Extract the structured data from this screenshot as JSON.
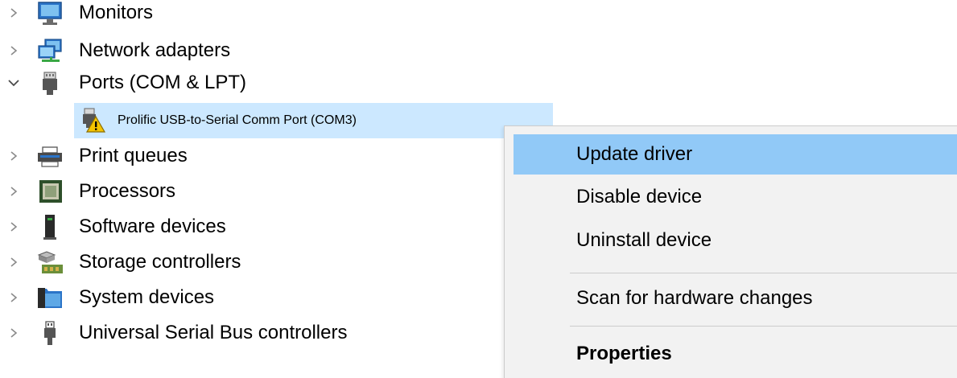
{
  "tree": {
    "items": [
      {
        "label": "Monitors",
        "icon": "monitor-icon",
        "expanded": false
      },
      {
        "label": "Network adapters",
        "icon": "network-adapter-icon",
        "expanded": false
      },
      {
        "label": "Ports (COM & LPT)",
        "icon": "port-icon",
        "expanded": true,
        "children": [
          {
            "label": "Prolific USB-to-Serial Comm Port (COM3)",
            "icon": "port-warning-icon",
            "selected": true
          }
        ]
      },
      {
        "label": "Print queues",
        "icon": "printer-icon",
        "expanded": false
      },
      {
        "label": "Processors",
        "icon": "processor-icon",
        "expanded": false
      },
      {
        "label": "Software devices",
        "icon": "software-device-icon",
        "expanded": false
      },
      {
        "label": "Storage controllers",
        "icon": "storage-controller-icon",
        "expanded": false
      },
      {
        "label": "System devices",
        "icon": "system-devices-icon",
        "expanded": false
      },
      {
        "label": "Universal Serial Bus controllers",
        "icon": "usb-icon",
        "expanded": false
      }
    ]
  },
  "context_menu": {
    "items": [
      {
        "label": "Update driver",
        "highlighted": true
      },
      {
        "label": "Disable device"
      },
      {
        "label": "Uninstall device"
      },
      {
        "label": "Scan for hardware changes"
      },
      {
        "label": "Properties",
        "bold": true
      }
    ]
  },
  "colors": {
    "selection": "#cce8ff",
    "menu_background": "#f2f2f2",
    "menu_highlight": "#91c9f7",
    "warning": "#f5c400"
  }
}
